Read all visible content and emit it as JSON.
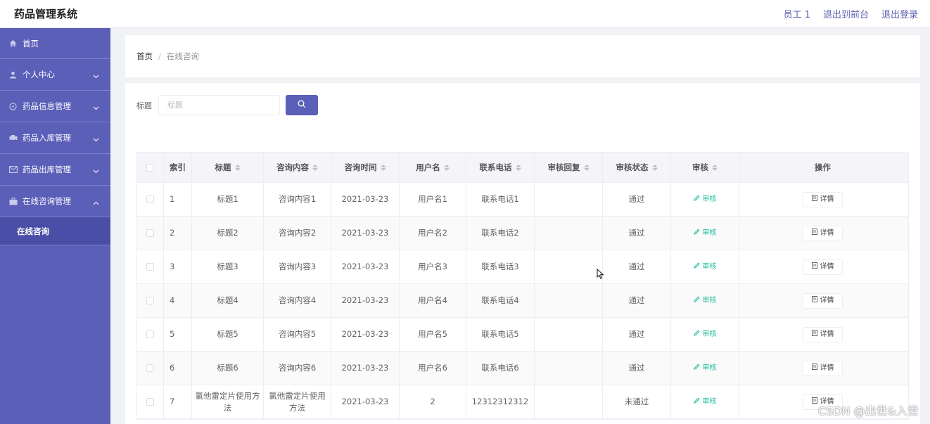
{
  "header": {
    "app_title": "药品管理系统",
    "links": [
      "员工 1",
      "退出到前台",
      "退出登录"
    ]
  },
  "sidebar": {
    "items": [
      {
        "label": "首页",
        "icon": "home-icon",
        "expandable": false
      },
      {
        "label": "个人中心",
        "icon": "user-icon",
        "expandable": true
      },
      {
        "label": "药品信息管理",
        "icon": "compass-icon",
        "expandable": true
      },
      {
        "label": "药品入库管理",
        "icon": "car-icon",
        "expandable": true
      },
      {
        "label": "药品出库管理",
        "icon": "mail-icon",
        "expandable": true
      },
      {
        "label": "在线咨询管理",
        "icon": "briefcase-icon",
        "expandable": true,
        "expanded": true
      }
    ],
    "subitems": [
      "在线咨询"
    ]
  },
  "breadcrumb": {
    "home": "首页",
    "separator": "/",
    "current": "在线咨询"
  },
  "search": {
    "label": "标题",
    "placeholder": "标题",
    "button_icon": "search-icon"
  },
  "table": {
    "headers": [
      "索引",
      "标题",
      "咨询内容",
      "咨询时间",
      "用户名",
      "联系电话",
      "审核回复",
      "审核状态",
      "审核",
      "操作"
    ],
    "rows": [
      {
        "index": "1",
        "title": "标题1",
        "content": "咨询内容1",
        "time": "2021-03-23",
        "username": "用户名1",
        "phone": "联系电话1",
        "reply": "",
        "status": "通过"
      },
      {
        "index": "2",
        "title": "标题2",
        "content": "咨询内容2",
        "time": "2021-03-23",
        "username": "用户名2",
        "phone": "联系电话2",
        "reply": "",
        "status": "通过"
      },
      {
        "index": "3",
        "title": "标题3",
        "content": "咨询内容3",
        "time": "2021-03-23",
        "username": "用户名3",
        "phone": "联系电话3",
        "reply": "",
        "status": "通过"
      },
      {
        "index": "4",
        "title": "标题4",
        "content": "咨询内容4",
        "time": "2021-03-23",
        "username": "用户名4",
        "phone": "联系电话4",
        "reply": "",
        "status": "通过"
      },
      {
        "index": "5",
        "title": "标题5",
        "content": "咨询内容5",
        "time": "2021-03-23",
        "username": "用户名5",
        "phone": "联系电话5",
        "reply": "",
        "status": "通过"
      },
      {
        "index": "6",
        "title": "标题6",
        "content": "咨询内容6",
        "time": "2021-03-23",
        "username": "用户名6",
        "phone": "联系电话6",
        "reply": "",
        "status": "通过"
      },
      {
        "index": "7",
        "title": "氯他雷定片使用方法",
        "content": "氯他雷定片使用方法",
        "time": "2021-03-23",
        "username": "2",
        "phone": "12312312312",
        "reply": "",
        "status": "未通过"
      }
    ],
    "audit_label": "审核",
    "detail_label": "详情"
  },
  "watermark": "CSDN @出世&入世",
  "colors": {
    "sidebar": "#5b5fb8",
    "accent": "#5b5fb8",
    "audit": "#1abc9c"
  }
}
